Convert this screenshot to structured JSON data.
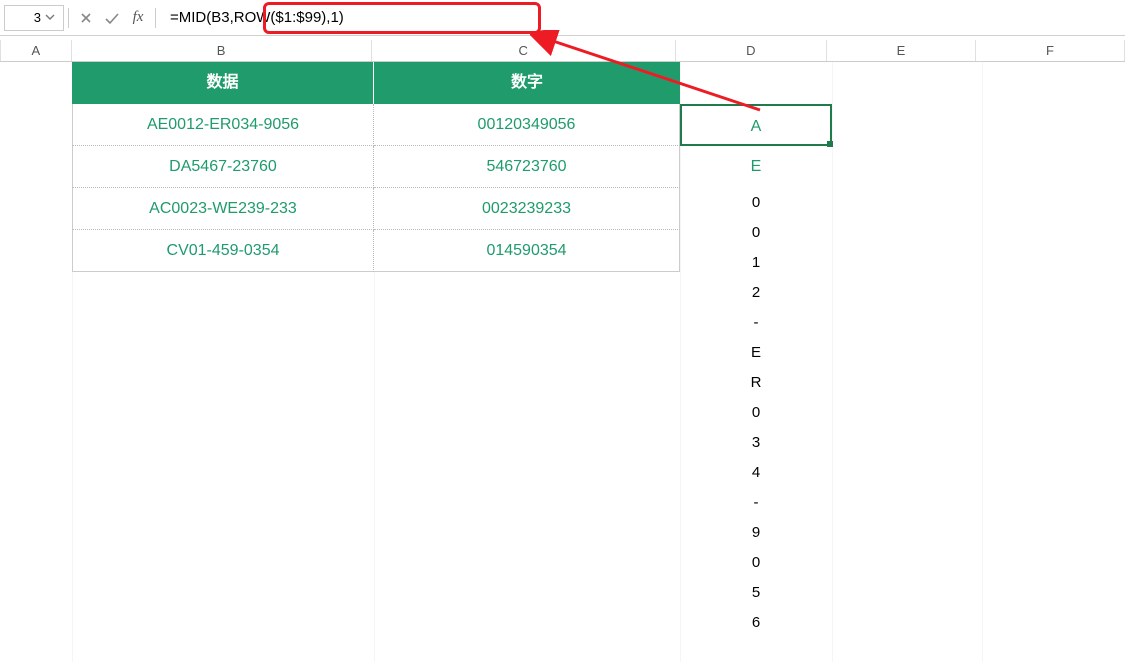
{
  "namebox": {
    "value": "3"
  },
  "formula_bar": {
    "fx_label": "fx",
    "formula": "=MID(B3,ROW($1:$99),1)"
  },
  "columns": {
    "A": "A",
    "B": "B",
    "C": "C",
    "D": "D",
    "E": "E",
    "F": "F"
  },
  "table": {
    "headers": {
      "b": "数据",
      "c": "数字"
    },
    "rows": [
      {
        "b": "AE0012-ER034-9056",
        "c": "00120349056"
      },
      {
        "b": "DA5467-23760",
        "c": "546723760"
      },
      {
        "b": "AC0023-WE239-233",
        "c": "0023239233"
      },
      {
        "b": "CV01-459-0354",
        "c": "014590354"
      }
    ]
  },
  "d_column": [
    "A",
    "E",
    "0",
    "0",
    "1",
    "2",
    "-",
    "E",
    "R",
    "0",
    "3",
    "4",
    "-",
    "9",
    "0",
    "5",
    "6"
  ],
  "colors": {
    "accent": "#1f9b6c",
    "highlight": "#ed1c24"
  }
}
